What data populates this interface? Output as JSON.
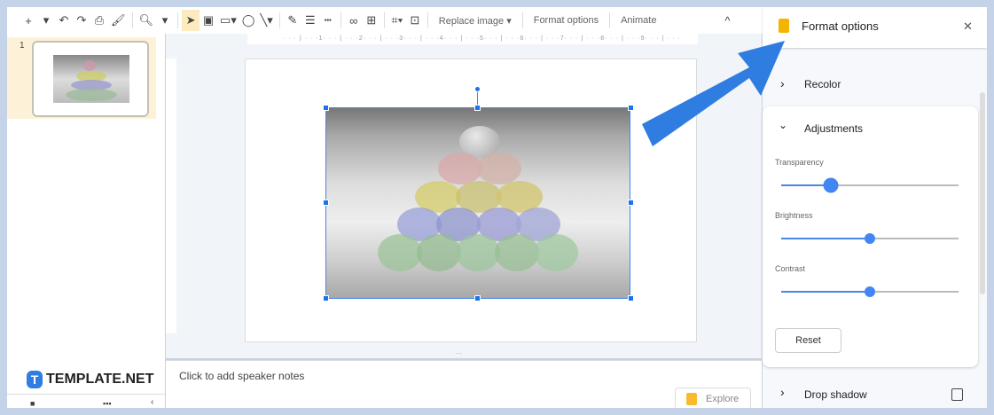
{
  "toolbar": {
    "icons": [
      "plus-icon",
      "dropdown-icon",
      "undo-icon",
      "redo-icon",
      "print-icon",
      "paint-format-icon",
      "zoom-icon",
      "dropdown-icon",
      "select-cursor-icon",
      "text-box-icon",
      "image-icon",
      "shape-icon",
      "line-icon",
      "pen-icon",
      "line-weight-icon",
      "line-dash-icon",
      "link-icon",
      "comment-icon",
      "crop-icon",
      "reset-image-icon"
    ],
    "replace_image": "Replace image ▾",
    "format_options": "Format options",
    "animate": "Animate",
    "collapse": "^"
  },
  "ruler": {
    "ticks": [
      "1",
      "2",
      "3",
      "4",
      "5",
      "6",
      "7",
      "8",
      "9"
    ]
  },
  "filmstrip": {
    "slide_number": "1"
  },
  "notes": {
    "placeholder": "Click to add speaker notes",
    "explore": "Explore"
  },
  "watermark": {
    "text": "TEMPLATE.NET"
  },
  "panel": {
    "title": "Format options",
    "close": "✕",
    "recolor": "Recolor",
    "adjustments": "Adjustments",
    "sliders": [
      {
        "label": "Transparency",
        "value": 28
      },
      {
        "label": "Brightness",
        "value": 50
      },
      {
        "label": "Contrast",
        "value": 50
      }
    ],
    "reset": "Reset",
    "drop_shadow": "Drop shadow",
    "drop_shadow_checked": false
  },
  "colors": {
    "accent": "#4285f4",
    "arrow": "#2f7de1",
    "frame": "#c5d3e8"
  }
}
